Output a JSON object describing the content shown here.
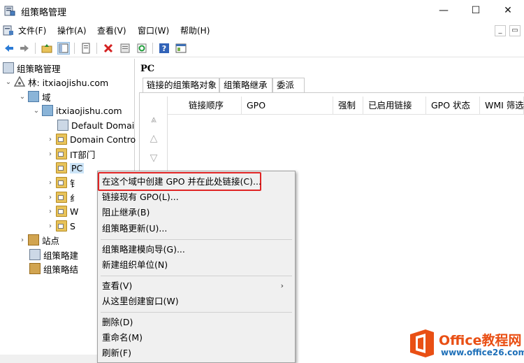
{
  "window": {
    "title": "组策略管理",
    "minimize": "—",
    "maximize": "☐",
    "close": "✕"
  },
  "menubar": {
    "items": [
      "文件(F)",
      "操作(A)",
      "查看(V)",
      "窗口(W)",
      "帮助(H)"
    ],
    "mdi_minimize": "_",
    "mdi_restore": "▭",
    "mdi_close": "×"
  },
  "toolbar": {
    "icons": [
      "back-arrow-icon",
      "forward-arrow-icon",
      "up-folder-icon",
      "show-hide-tree-icon",
      "properties-icon",
      "delete-icon",
      "export-list-icon",
      "refresh-icon",
      "help-icon",
      "console-icon"
    ]
  },
  "tree": {
    "root": "组策略管理",
    "forest": "林: itxiaojishu.com",
    "domains": "域",
    "domain": "itxiaojishu.com",
    "children": [
      "Default Domai",
      "Domain Contro",
      "IT部门",
      "PC",
      "钅",
      "纟",
      "W",
      "S"
    ],
    "sites": "站点",
    "gpo_modeling": "组策略建",
    "gpo_results": "组策略结"
  },
  "right": {
    "header": "PC",
    "tabs": [
      "链接的组策略对象",
      "组策略继承",
      "委派"
    ],
    "columns": [
      "链接顺序",
      "GPO",
      "强制",
      "已启用链接",
      "GPO 状态",
      "WMI 筛选"
    ]
  },
  "context_menu": {
    "items": [
      "在这个域中创建 GPO 并在此处链接(C)...",
      "链接现有 GPO(L)...",
      "阻止继承(B)",
      "组策略更新(U)...",
      "组策略建模向导(G)...",
      "新建组织单位(N)",
      "查看(V)",
      "从这里创建窗口(W)",
      "删除(D)",
      "重命名(M)",
      "刷新(F)"
    ],
    "submenu_arrow": "›"
  },
  "watermark": {
    "title": "Office教程网",
    "url": "www.office26.com"
  },
  "colors": {
    "highlight_border": "#e02424",
    "selection": "#cce4f7",
    "brand_orange": "#e94f14",
    "brand_blue": "#1d6fb8"
  }
}
